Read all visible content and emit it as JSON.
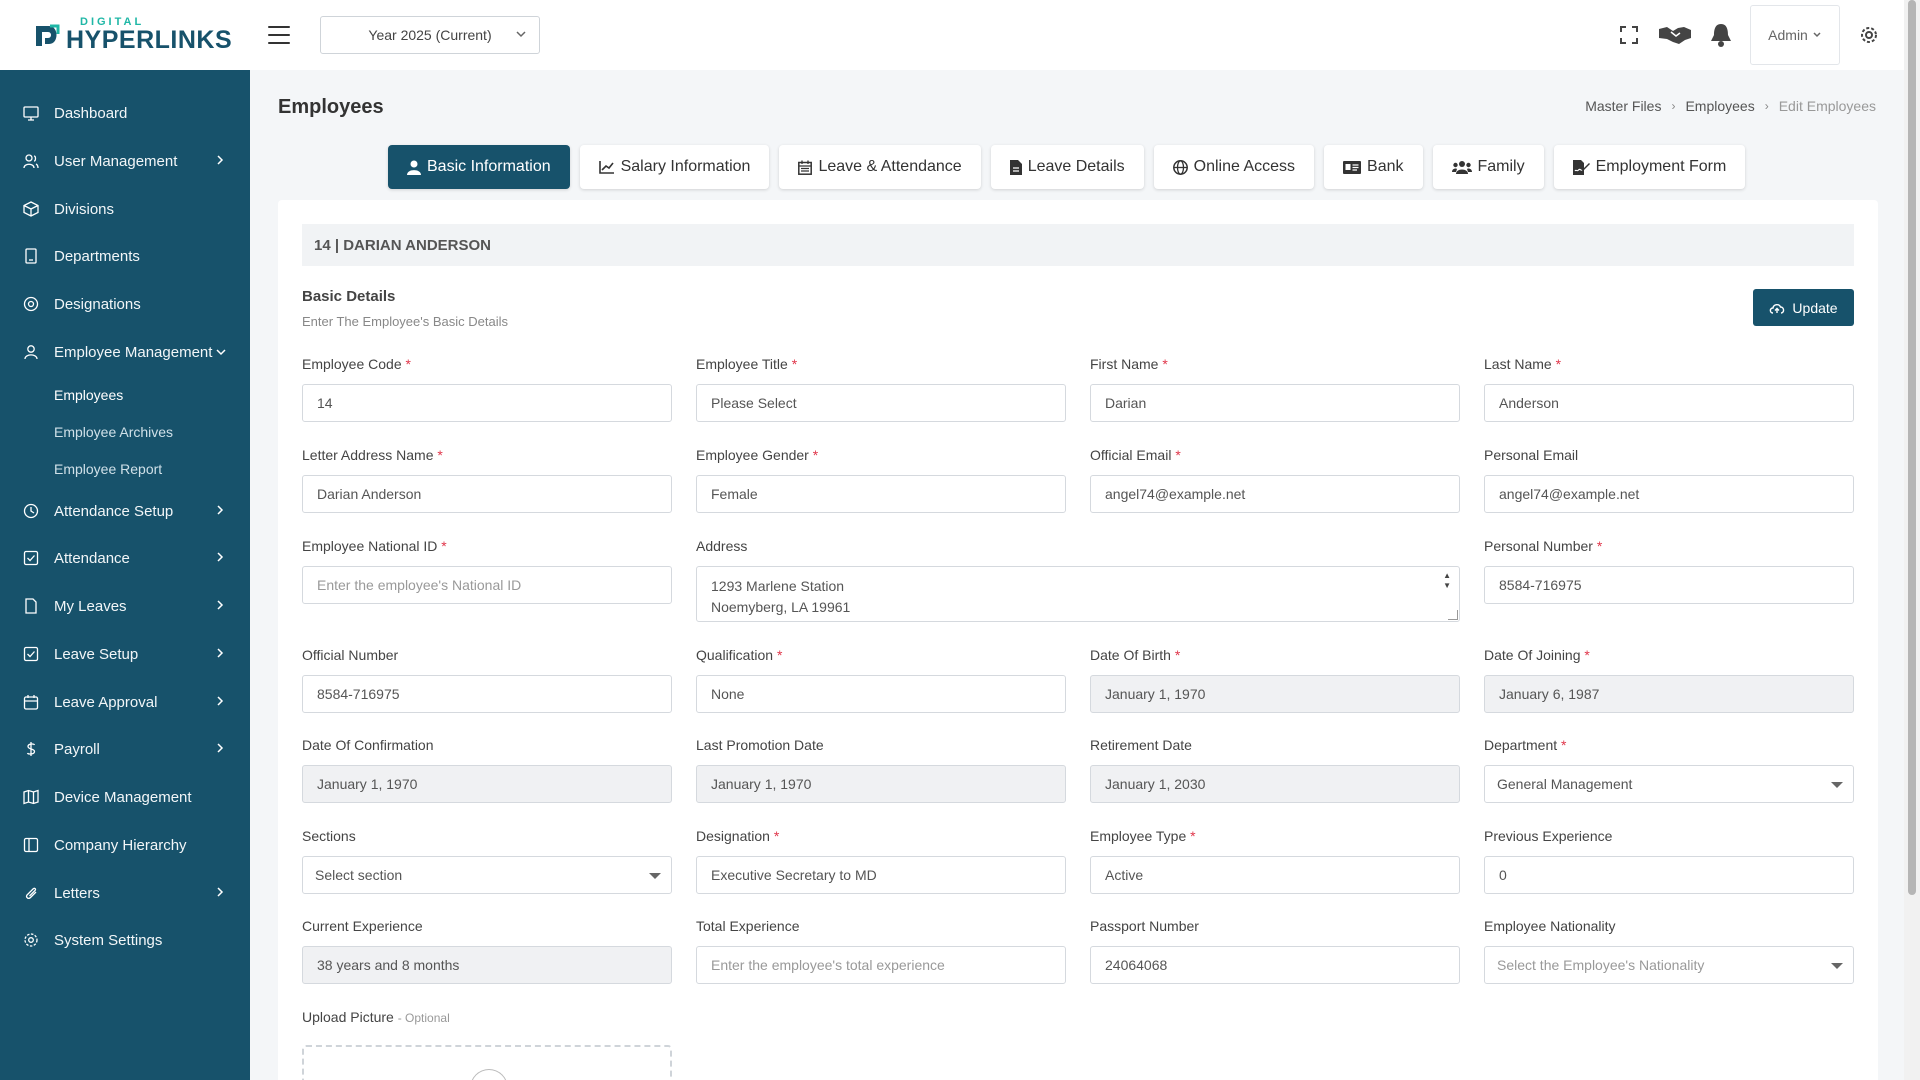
{
  "colors": {
    "primary": "#17526b",
    "accent": "#1fb7a6",
    "required": "#e0364a"
  },
  "logo": {
    "top": "DIGITAL",
    "bottom": "HYPERLINKS"
  },
  "header": {
    "year_select": "Year 2025 (Current)",
    "admin_label": "Admin"
  },
  "sidebar": {
    "items": [
      {
        "label": "Dashboard",
        "icon": "monitor-icon"
      },
      {
        "label": "User Management",
        "icon": "users-icon"
      },
      {
        "label": "Divisions",
        "icon": "cube-icon"
      },
      {
        "label": "Departments",
        "icon": "building-icon"
      },
      {
        "label": "Designations",
        "icon": "target-icon"
      },
      {
        "label": "Employee Management",
        "icon": "user-icon"
      },
      {
        "label": "Attendance Setup",
        "icon": "clock-icon"
      },
      {
        "label": "Attendance",
        "icon": "check-square-icon"
      },
      {
        "label": "My Leaves",
        "icon": "file-icon"
      },
      {
        "label": "Leave Setup",
        "icon": "check-square-icon"
      },
      {
        "label": "Leave Approval",
        "icon": "calendar-icon"
      },
      {
        "label": "Payroll",
        "icon": "dollar-icon"
      },
      {
        "label": "Device Management",
        "icon": "map-icon"
      },
      {
        "label": "Company Hierarchy",
        "icon": "columns-icon"
      },
      {
        "label": "Letters",
        "icon": "paperclip-icon"
      },
      {
        "label": "System Settings",
        "icon": "gear-icon"
      }
    ],
    "sub_items": [
      "Employees",
      "Employee Archives",
      "Employee Report"
    ]
  },
  "page": {
    "title": "Employees",
    "breadcrumb": [
      "Master Files",
      "Employees",
      "Edit Employees"
    ]
  },
  "tabs": [
    {
      "label": "Basic Information",
      "icon": "user-icon"
    },
    {
      "label": "Salary Information",
      "icon": "chart-line-icon"
    },
    {
      "label": "Leave & Attendance",
      "icon": "calendar-icon"
    },
    {
      "label": "Leave Details",
      "icon": "file-icon"
    },
    {
      "label": "Online Access",
      "icon": "globe-icon"
    },
    {
      "label": "Bank",
      "icon": "id-card-icon"
    },
    {
      "label": "Family",
      "icon": "users-icon"
    },
    {
      "label": "Employment Form",
      "icon": "file-signature-icon"
    }
  ],
  "form": {
    "employee_banner": "14 | DARIAN ANDERSON",
    "section_title": "Basic Details",
    "section_subtitle": "Enter The Employee's Basic Details",
    "update_label": "Update",
    "fields": {
      "employee_code": {
        "label": "Employee Code",
        "value": "14"
      },
      "employee_title": {
        "label": "Employee Title",
        "placeholder": "Please Select"
      },
      "first_name": {
        "label": "First Name",
        "value": "Darian"
      },
      "last_name": {
        "label": "Last Name",
        "value": "Anderson"
      },
      "letter_address_name": {
        "label": "Letter Address Name",
        "value": "Darian Anderson"
      },
      "employee_gender": {
        "label": "Employee Gender",
        "value": "Female"
      },
      "official_email": {
        "label": "Official Email",
        "value": "angel74@example.net"
      },
      "personal_email": {
        "label": "Personal Email",
        "value": "angel74@example.net"
      },
      "national_id": {
        "label": "Employee National ID",
        "placeholder": "Enter the employee's National ID"
      },
      "address": {
        "label": "Address",
        "line1": "1293 Marlene Station",
        "line2": "Noemyberg, LA 19961"
      },
      "personal_number": {
        "label": "Personal Number",
        "value": "8584-716975"
      },
      "official_number": {
        "label": "Official Number",
        "value": "8584-716975"
      },
      "qualification": {
        "label": "Qualification",
        "value": "None"
      },
      "date_of_birth": {
        "label": "Date Of Birth",
        "value": "January 1, 1970"
      },
      "date_of_joining": {
        "label": "Date Of Joining",
        "value": "January 6, 1987"
      },
      "date_of_confirmation": {
        "label": "Date Of Confirmation",
        "value": "January 1, 1970"
      },
      "last_promotion_date": {
        "label": "Last Promotion Date",
        "value": "January 1, 1970"
      },
      "retirement_date": {
        "label": "Retirement Date",
        "value": "January 1, 2030"
      },
      "department": {
        "label": "Department",
        "value": "General Management"
      },
      "sections": {
        "label": "Sections",
        "value": "Select section"
      },
      "designation": {
        "label": "Designation",
        "value": "Executive Secretary to MD"
      },
      "employee_type": {
        "label": "Employee Type",
        "value": "Active"
      },
      "previous_experience": {
        "label": "Previous Experience",
        "value": "0"
      },
      "current_experience": {
        "label": "Current Experience",
        "value": "38 years and 8 months"
      },
      "total_experience": {
        "label": "Total Experience",
        "placeholder": "Enter the employee's total experience"
      },
      "passport_number": {
        "label": "Passport Number",
        "value": "24064068"
      },
      "nationality": {
        "label": "Employee Nationality",
        "placeholder": "Select the Employee's Nationality"
      },
      "upload_picture": {
        "label": "Upload Picture",
        "optional": "- Optional"
      }
    }
  }
}
